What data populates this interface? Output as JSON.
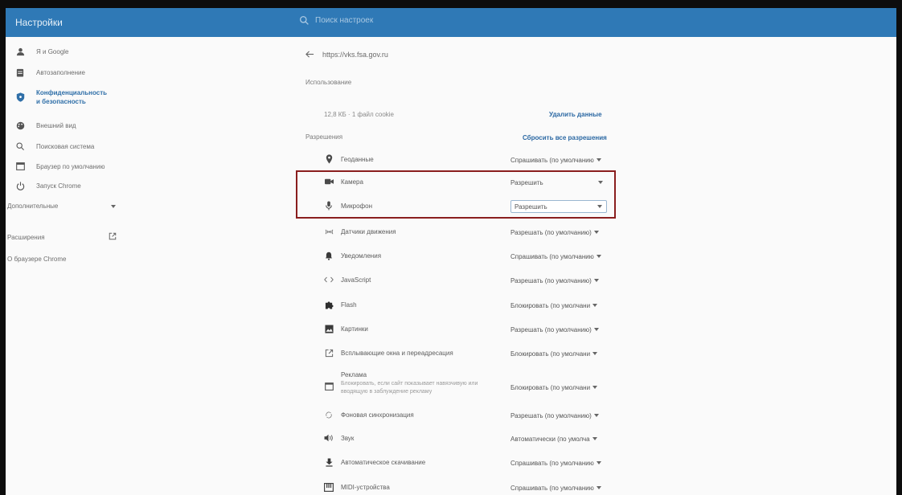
{
  "header": {
    "title": "Настройки",
    "search_placeholder": "Поиск настроек"
  },
  "sidebar": {
    "items": [
      {
        "label": "Я и Google",
        "icon": "person-icon"
      },
      {
        "label": "Автозаполнение",
        "icon": "clipboard-icon"
      },
      {
        "label": "Конфиденциальность и безопасность",
        "icon": "shield-icon",
        "active": true
      },
      {
        "label": "Внешний вид",
        "icon": "palette-icon"
      },
      {
        "label": "Поисковая система",
        "icon": "search-icon"
      },
      {
        "label": "Браузер по умолчанию",
        "icon": "browser-icon"
      },
      {
        "label": "Запуск Chrome",
        "icon": "power-icon"
      }
    ],
    "advanced_label": "Дополнительные",
    "extensions_label": "Расширения",
    "about_label": "О браузере Chrome"
  },
  "main": {
    "site_url": "https://vks.fsa.gov.ru",
    "usage_label": "Использование",
    "usage_text": "12,8 КБ · 1 файл cookie",
    "delete_data_label": "Удалить данные",
    "permissions_label": "Разрешения",
    "reset_permissions_label": "Сбросить все разрешения",
    "permissions": [
      {
        "label": "Геоданные",
        "icon": "location-icon",
        "value": "Спрашивать (по умолчанию"
      },
      {
        "label": "Камера",
        "icon": "camera-icon",
        "value": "Разрешить"
      },
      {
        "label": "Микрофон",
        "icon": "microphone-icon",
        "value": "Разрешить"
      },
      {
        "label": "Датчики движения",
        "icon": "motion-sensor-icon",
        "value": "Разрешать (по умолчанию)"
      },
      {
        "label": "Уведомления",
        "icon": "bell-icon",
        "value": "Спрашивать (по умолчанию"
      },
      {
        "label": "JavaScript",
        "icon": "code-icon",
        "value": "Разрешать (по умолчанию)"
      },
      {
        "label": "Flash",
        "icon": "puzzle-icon",
        "value": "Блокировать (по умолчани"
      },
      {
        "label": "Картинки",
        "icon": "image-icon",
        "value": "Разрешать (по умолчанию)"
      },
      {
        "label": "Всплывающие окна и переадресация",
        "icon": "popup-icon",
        "value": "Блокировать (по умолчани"
      },
      {
        "label": "Реклама",
        "icon": "ads-icon",
        "value": "Блокировать (по умолчани",
        "description": "Блокировать, если сайт показывает навязчивую или вводящую в заблуждение рекламу"
      },
      {
        "label": "Фоновая синхронизация",
        "icon": "sync-icon",
        "value": "Разрешать (по умолчанию)"
      },
      {
        "label": "Звук",
        "icon": "sound-icon",
        "value": "Автоматически (по умолча"
      },
      {
        "label": "Автоматическое скачивание",
        "icon": "download-icon",
        "value": "Спрашивать (по умолчанию"
      },
      {
        "label": "MIDI-устройства",
        "icon": "midi-icon",
        "value": "Спрашивать (по умолчанию"
      }
    ]
  },
  "colors": {
    "header_bg": "#2f79b6",
    "accent": "#2b68a3",
    "highlight_border": "#8a1e1e"
  }
}
